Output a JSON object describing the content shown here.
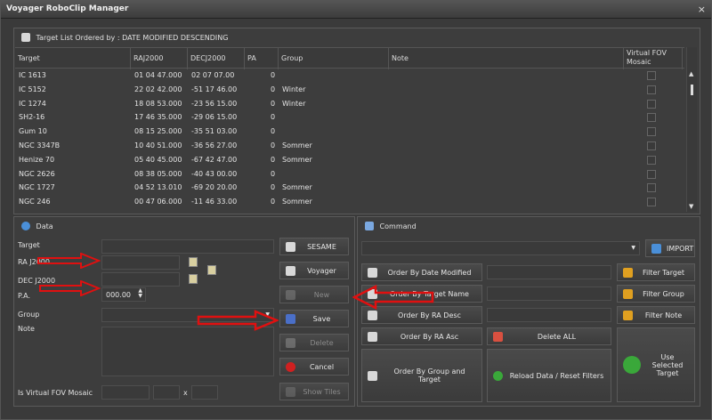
{
  "window": {
    "title": "Voyager RoboClip Manager",
    "close_glyph": "×"
  },
  "target_list": {
    "header": "Target List Ordered by : DATE MODIFIED DESCENDING",
    "columns": [
      "Target",
      "RAJ2000",
      "DECJ2000",
      "PA",
      "Group",
      "Note",
      "Virtual FOV Mosaic"
    ],
    "rows": [
      {
        "target": "IC 1613",
        "ra": "01 04 47.000",
        "dec": "02 07 07.00",
        "pa": "0",
        "group": "",
        "note": ""
      },
      {
        "target": "IC 5152",
        "ra": "22 02 42.000",
        "dec": "-51 17 46.00",
        "pa": "0",
        "group": "Winter",
        "note": ""
      },
      {
        "target": "IC 1274",
        "ra": "18 08 53.000",
        "dec": "-23 56 15.00",
        "pa": "0",
        "group": "Winter",
        "note": ""
      },
      {
        "target": "SH2-16",
        "ra": "17 46 35.000",
        "dec": "-29 06 15.00",
        "pa": "0",
        "group": "",
        "note": ""
      },
      {
        "target": "Gum 10",
        "ra": "08 15 25.000",
        "dec": "-35 51 03.00",
        "pa": "0",
        "group": "",
        "note": ""
      },
      {
        "target": "NGC 3347B",
        "ra": "10 40 51.000",
        "dec": "-36 56 27.00",
        "pa": "0",
        "group": "Sommer",
        "note": ""
      },
      {
        "target": "Henize 70",
        "ra": "05 40 45.000",
        "dec": "-67 42 47.00",
        "pa": "0",
        "group": "Sommer",
        "note": ""
      },
      {
        "target": "NGC 2626",
        "ra": "08 38 05.000",
        "dec": "-40 43 00.00",
        "pa": "0",
        "group": "",
        "note": ""
      },
      {
        "target": "NGC 1727",
        "ra": "04 52 13.010",
        "dec": "-69 20 20.00",
        "pa": "0",
        "group": "Sommer",
        "note": ""
      },
      {
        "target": "NGC 246",
        "ra": "00 47 06.000",
        "dec": "-11 46 33.00",
        "pa": "0",
        "group": "Sommer",
        "note": ""
      }
    ]
  },
  "data_panel": {
    "header": "Data",
    "labels": {
      "target": "Target",
      "ra": "RA J2000",
      "dec": "DEC J2000",
      "pa": "P.A.",
      "group": "Group",
      "note": "Note",
      "vfov": "Is Virtual FOV Mosaic",
      "x": "x"
    },
    "pa_value": "000.00",
    "buttons": {
      "sesame": "SESAME",
      "voyager": "Voyager",
      "new": "New",
      "save": "Save",
      "delete": "Delete",
      "cancel": "Cancel",
      "show_tiles": "Show Tiles"
    }
  },
  "command_panel": {
    "header": "Command",
    "buttons": {
      "import": "IMPORT",
      "order_date": "Order By Date Modified",
      "order_name": "Order By Target Name",
      "order_ra_desc": "Order By RA Desc",
      "order_ra_asc": "Order By RA Asc",
      "order_group": "Order By Group and Target",
      "delete_all": "Delete ALL",
      "reload": "Reload Data / Reset Filters",
      "filter_target": "Filter Target",
      "filter_group": "Filter Group",
      "filter_note": "Filter Note",
      "use_selected": "Use Selected Target"
    }
  },
  "colors": {
    "annotation_arrow": "#e01010",
    "accent_green": "#3aa83a",
    "filter_icon": "#e0a020"
  }
}
